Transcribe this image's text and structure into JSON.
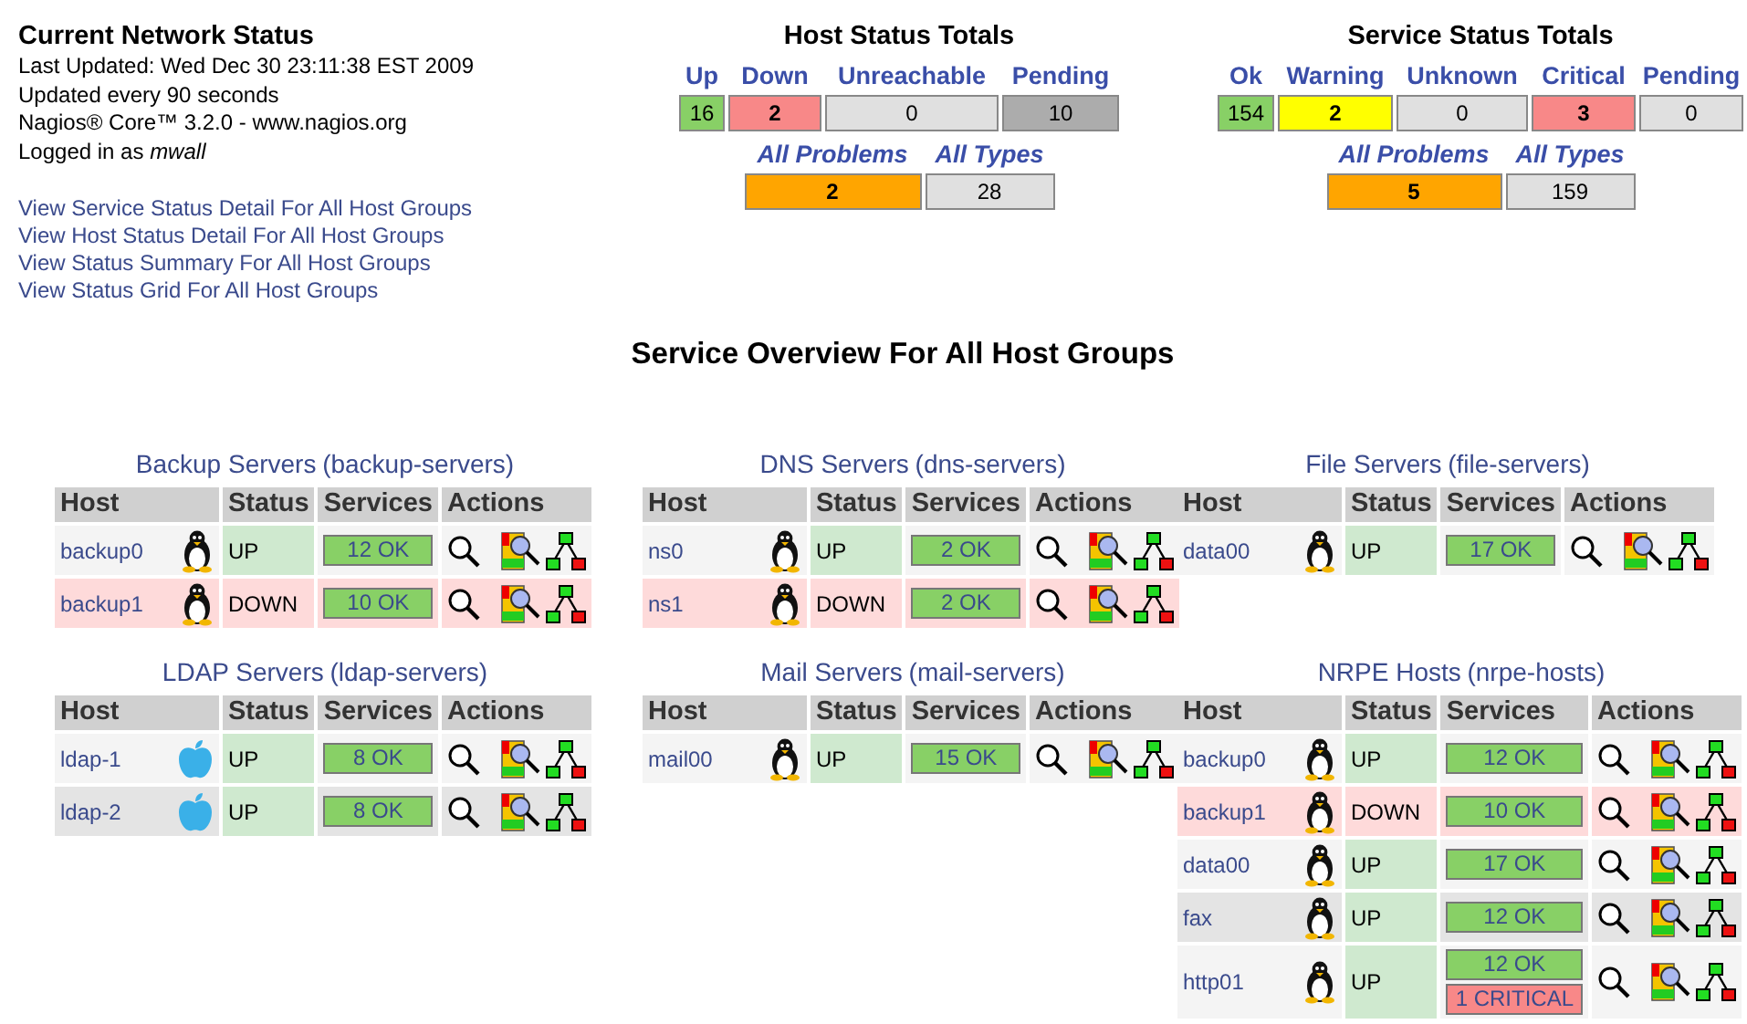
{
  "header": {
    "title": "Current Network Status",
    "last_updated": "Last Updated: Wed Dec 30 23:11:38 EST 2009",
    "refresh": "Updated every 90 seconds",
    "version": "Nagios® Core™ 3.2.0 - www.nagios.org",
    "login": "Logged in as *mwall*"
  },
  "links": [
    "View Service Status Detail For All Host Groups",
    "View Host Status Detail For All Host Groups",
    "View Status Summary For All Host Groups",
    "View Status Grid For All Host Groups"
  ],
  "host_totals": {
    "title": "Host Status Totals",
    "columns": [
      {
        "label": "Up",
        "value": "16",
        "kind": "ok"
      },
      {
        "label": "Down",
        "value": "2",
        "kind": "bad"
      },
      {
        "label": "Unreachable",
        "value": "0",
        "kind": "neutral"
      },
      {
        "label": "Pending",
        "value": "10",
        "kind": "pending"
      }
    ],
    "summary": [
      {
        "label": "All Problems",
        "value": "2",
        "kind": "problem"
      },
      {
        "label": "All Types",
        "value": "28",
        "kind": "neutral"
      }
    ]
  },
  "service_totals": {
    "title": "Service Status Totals",
    "columns": [
      {
        "label": "Ok",
        "value": "154",
        "kind": "ok"
      },
      {
        "label": "Warning",
        "value": "2",
        "kind": "warning"
      },
      {
        "label": "Unknown",
        "value": "0",
        "kind": "neutral"
      },
      {
        "label": "Critical",
        "value": "3",
        "kind": "bad"
      },
      {
        "label": "Pending",
        "value": "0",
        "kind": "neutral"
      }
    ],
    "summary": [
      {
        "label": "All Problems",
        "value": "5",
        "kind": "problem"
      },
      {
        "label": "All Types",
        "value": "159",
        "kind": "neutral"
      }
    ]
  },
  "overview_title": "Service Overview For All Host Groups",
  "groups": [
    {
      "name": "Backup Servers",
      "alias": "(backup-servers)",
      "columns": [
        "Host",
        "Status",
        "Services",
        "Actions"
      ],
      "hosts": [
        {
          "name": "backup0",
          "kind": "linux",
          "status": "UP",
          "problem": false,
          "services": [
            {
              "text": "12 OK",
              "kind": "ok"
            }
          ]
        },
        {
          "name": "backup1",
          "kind": "linux",
          "status": "DOWN",
          "problem": true,
          "services": [
            {
              "text": "10 OK",
              "kind": "ok"
            }
          ]
        }
      ]
    },
    {
      "name": "DNS Servers",
      "alias": "(dns-servers)",
      "columns": [
        "Host",
        "Status",
        "Services",
        "Actions"
      ],
      "hosts": [
        {
          "name": "ns0",
          "kind": "linux",
          "status": "UP",
          "problem": false,
          "services": [
            {
              "text": "2 OK",
              "kind": "ok"
            }
          ]
        },
        {
          "name": "ns1",
          "kind": "linux",
          "status": "DOWN",
          "problem": true,
          "services": [
            {
              "text": "2 OK",
              "kind": "ok"
            }
          ]
        }
      ]
    },
    {
      "name": "File Servers",
      "alias": "(file-servers)",
      "columns": [
        "Host",
        "Status",
        "Services",
        "Actions"
      ],
      "hosts": [
        {
          "name": "data00",
          "kind": "linux",
          "status": "UP",
          "problem": false,
          "services": [
            {
              "text": "17 OK",
              "kind": "ok"
            }
          ]
        }
      ]
    },
    {
      "name": "LDAP Servers",
      "alias": "(ldap-servers)",
      "columns": [
        "Host",
        "Status",
        "Services",
        "Actions"
      ],
      "hosts": [
        {
          "name": "ldap-1",
          "kind": "apple",
          "status": "UP",
          "problem": false,
          "services": [
            {
              "text": "8 OK",
              "kind": "ok"
            }
          ]
        },
        {
          "name": "ldap-2",
          "kind": "apple",
          "status": "UP",
          "problem": false,
          "services": [
            {
              "text": "8 OK",
              "kind": "ok"
            }
          ]
        }
      ]
    },
    {
      "name": "Mail Servers",
      "alias": "(mail-servers)",
      "columns": [
        "Host",
        "Status",
        "Services",
        "Actions"
      ],
      "hosts": [
        {
          "name": "mail00",
          "kind": "linux",
          "status": "UP",
          "problem": false,
          "services": [
            {
              "text": "15 OK",
              "kind": "ok"
            }
          ]
        }
      ]
    },
    {
      "name": "NRPE Hosts",
      "alias": "(nrpe-hosts)",
      "columns": [
        "Host",
        "Status",
        "Services",
        "Actions"
      ],
      "hosts": [
        {
          "name": "backup0",
          "kind": "linux",
          "status": "UP",
          "problem": false,
          "services": [
            {
              "text": "12 OK",
              "kind": "ok"
            }
          ]
        },
        {
          "name": "backup1",
          "kind": "linux",
          "status": "DOWN",
          "problem": true,
          "services": [
            {
              "text": "10 OK",
              "kind": "ok"
            }
          ]
        },
        {
          "name": "data00",
          "kind": "linux",
          "status": "UP",
          "problem": false,
          "services": [
            {
              "text": "17 OK",
              "kind": "ok"
            }
          ]
        },
        {
          "name": "fax",
          "kind": "linux",
          "status": "UP",
          "problem": false,
          "services": [
            {
              "text": "12 OK",
              "kind": "ok"
            }
          ]
        },
        {
          "name": "http01",
          "kind": "linux",
          "status": "UP",
          "problem": false,
          "services": [
            {
              "text": "12 OK",
              "kind": "ok"
            },
            {
              "text": "1 CRITICAL",
              "kind": "critical"
            }
          ]
        }
      ]
    }
  ]
}
